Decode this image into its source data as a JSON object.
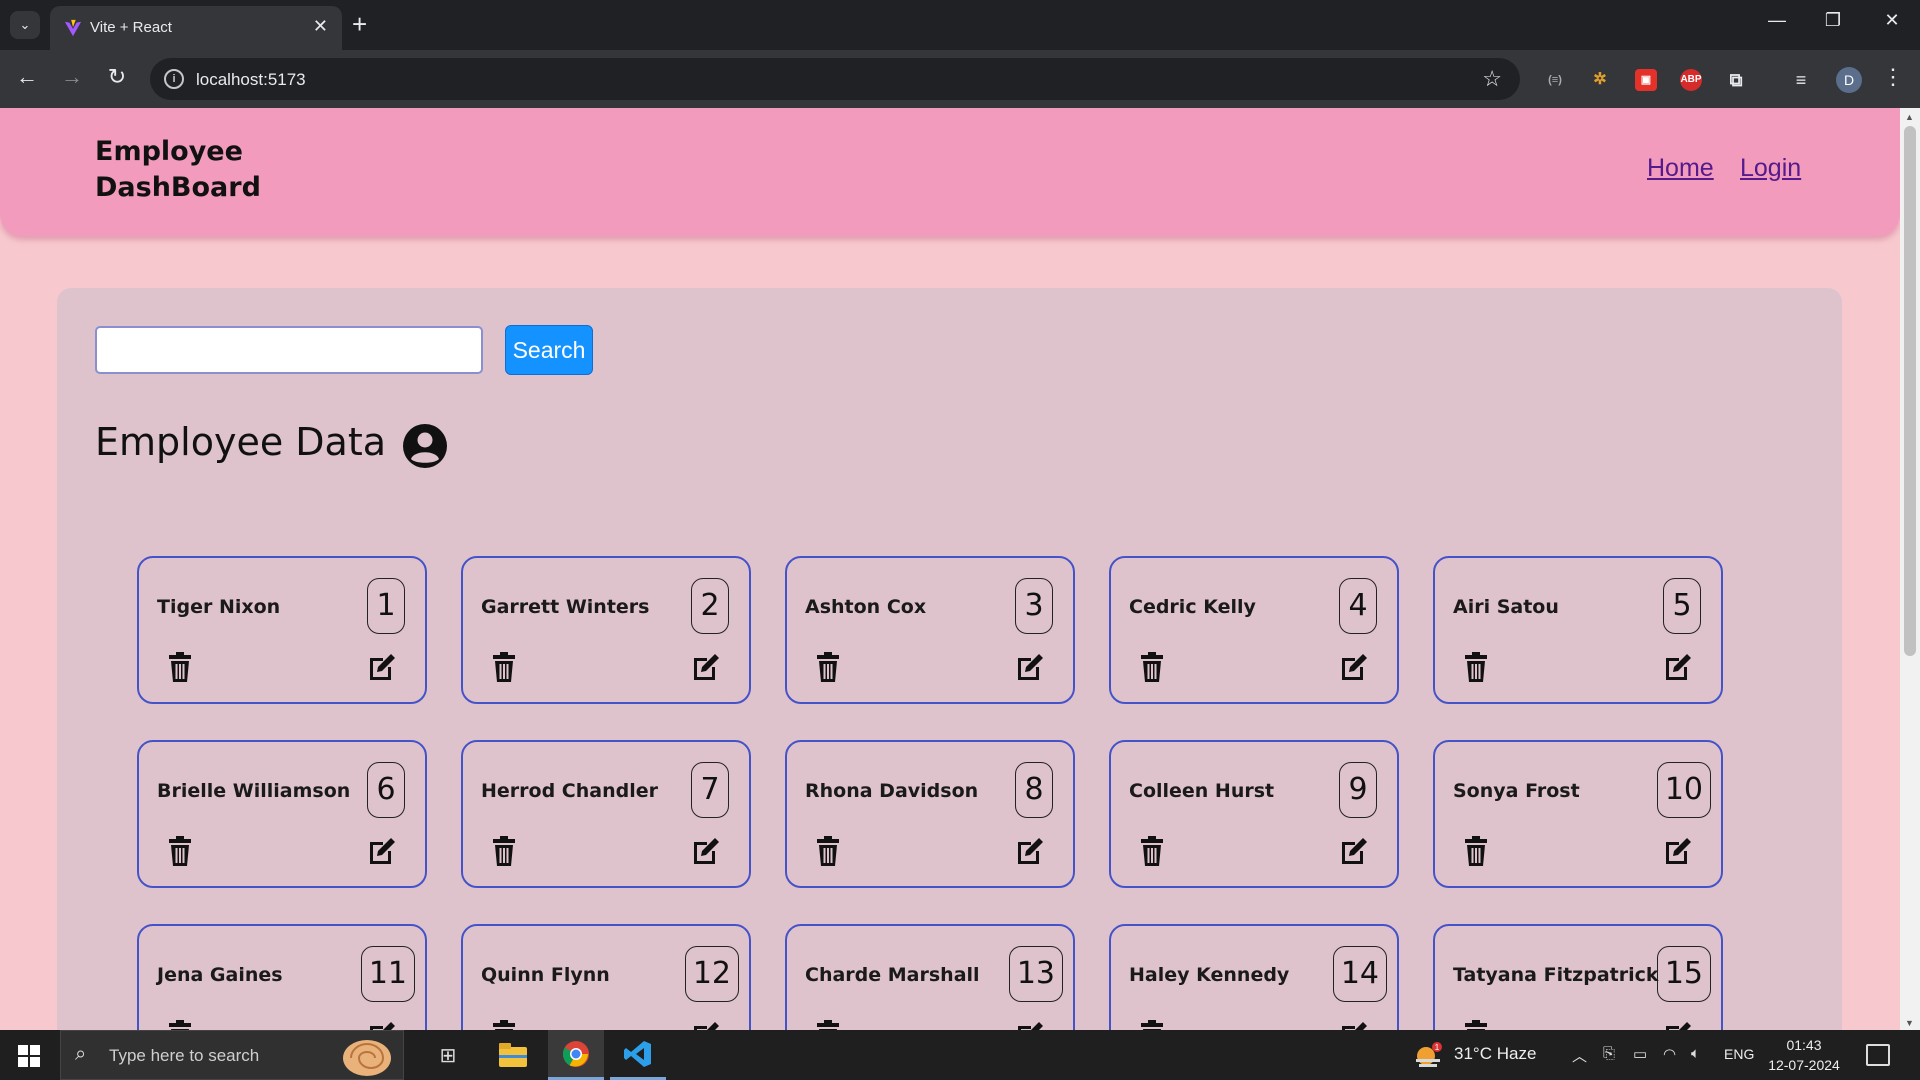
{
  "browser": {
    "tab_title": "Vite + React",
    "url": "localhost:5173",
    "profile_initial": "D"
  },
  "header": {
    "brand_line1": "Employee",
    "brand_line2": "DashBoard",
    "nav": [
      "Home",
      "Login"
    ]
  },
  "search": {
    "value": "",
    "placeholder": "",
    "button_label": "Search"
  },
  "section_title": "Employee Data",
  "employees": [
    {
      "name": "Tiger Nixon",
      "id": "1"
    },
    {
      "name": "Garrett Winters",
      "id": "2"
    },
    {
      "name": "Ashton Cox",
      "id": "3"
    },
    {
      "name": "Cedric Kelly",
      "id": "4"
    },
    {
      "name": "Airi Satou",
      "id": "5"
    },
    {
      "name": "Brielle Williamson",
      "id": "6"
    },
    {
      "name": "Herrod Chandler",
      "id": "7"
    },
    {
      "name": "Rhona Davidson",
      "id": "8"
    },
    {
      "name": "Colleen Hurst",
      "id": "9"
    },
    {
      "name": "Sonya Frost",
      "id": "10"
    },
    {
      "name": "Jena Gaines",
      "id": "11"
    },
    {
      "name": "Quinn Flynn",
      "id": "12"
    },
    {
      "name": "Charde Marshall",
      "id": "13"
    },
    {
      "name": "Haley Kennedy",
      "id": "14"
    },
    {
      "name": "Tatyana Fitzpatrick",
      "id": "15"
    }
  ],
  "taskbar": {
    "search_placeholder": "Type here to search",
    "weather": "31°C  Haze",
    "weather_badge": "1",
    "language": "ENG",
    "time": "01:43",
    "date": "12-07-2024"
  },
  "colors": {
    "page_bg": "#f7c9ce",
    "header_bg": "#f29bbc",
    "panel_bg": "#dfc3cc",
    "card_border": "#4553c9",
    "search_button": "#1492ff",
    "link": "#551a8b"
  }
}
